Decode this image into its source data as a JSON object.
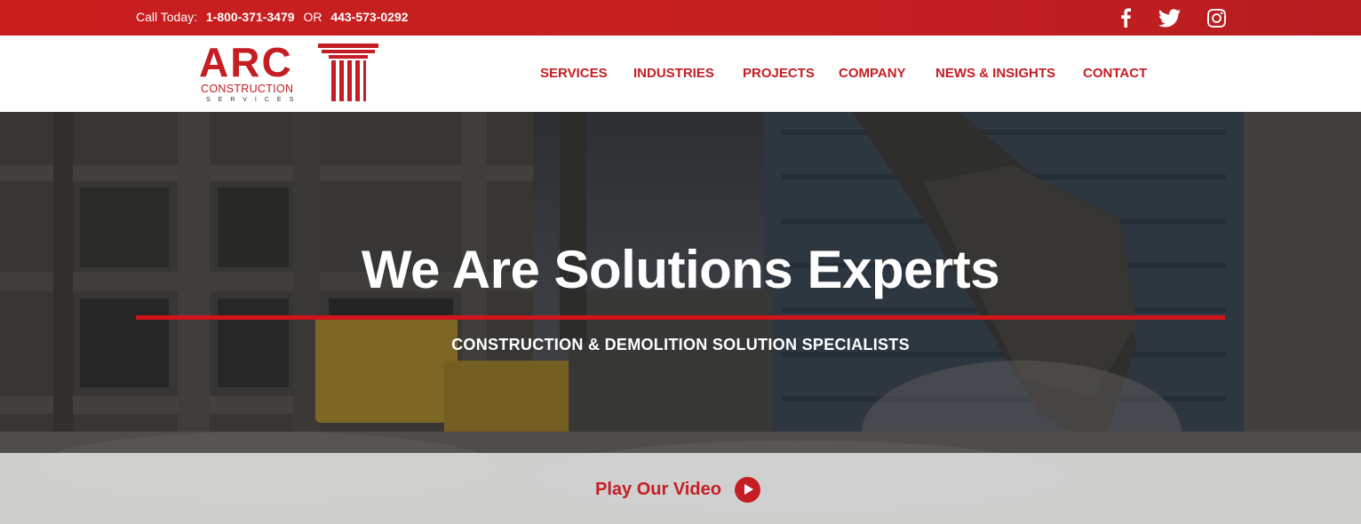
{
  "topbar": {
    "call_label": "Call Today:",
    "phone_1": "1-800-371-3479",
    "or_text": "OR",
    "phone_2": "443-573-0292",
    "social_icons": [
      "facebook-icon",
      "twitter-icon",
      "instagram-icon"
    ]
  },
  "logo": {
    "name": "ARC",
    "line_1": "CONSTRUCTION",
    "line_2": "SERVICES"
  },
  "nav": {
    "items": [
      {
        "label": "SERVICES"
      },
      {
        "label": "INDUSTRIES"
      },
      {
        "label": "PROJECTS"
      },
      {
        "label": "COMPANY"
      },
      {
        "label": "NEWS & INSIGHTS"
      },
      {
        "label": "CONTACT"
      }
    ]
  },
  "hero": {
    "title": "We Are Solutions Experts",
    "subtitle": "CONSTRUCTION & DEMOLITION SOLUTION SPECIALISTS",
    "video_label": "Play Our Video"
  },
  "colors": {
    "brand_red": "#c41e24",
    "accent_line": "#d0141b",
    "white": "#ffffff"
  }
}
